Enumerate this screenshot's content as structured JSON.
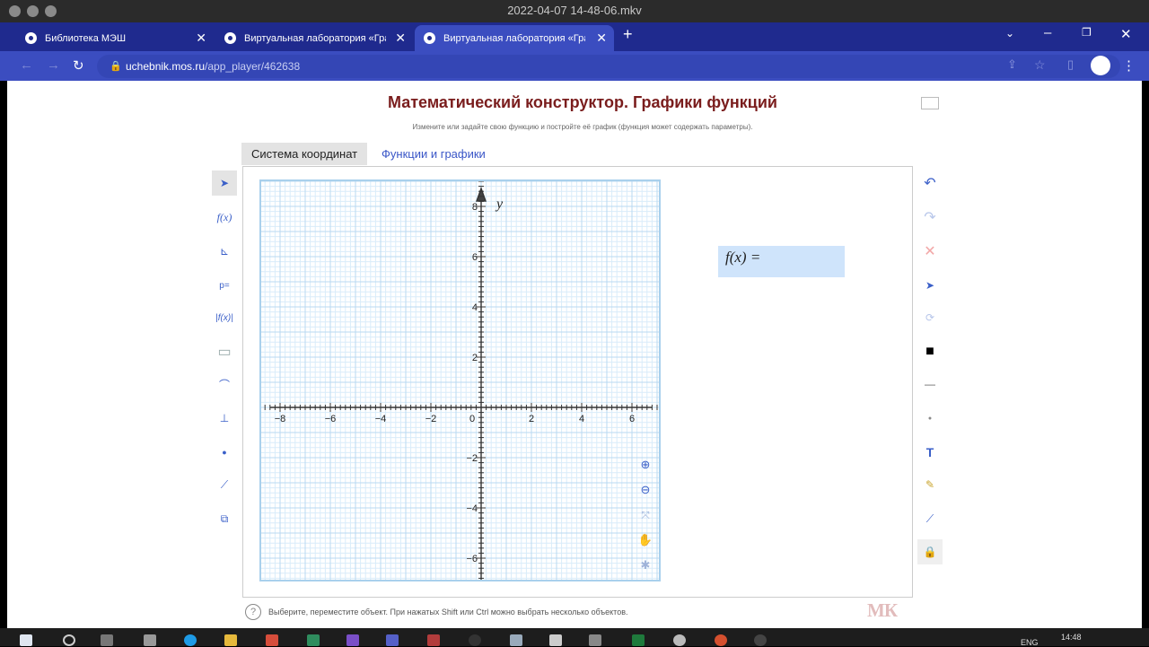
{
  "window": {
    "title": "2022-04-07 14-48-06.mkv"
  },
  "browser": {
    "tabs": [
      {
        "label": "Библиотека МЭШ",
        "active": false
      },
      {
        "label": "Виртуальная лаборатория «Гра",
        "active": false
      },
      {
        "label": "Виртуальная лаборатория «Гра",
        "active": true
      }
    ],
    "url_host": "uchebnik.mos.ru",
    "url_path": "/app_player/462638"
  },
  "app": {
    "title": "Математический конструктор. Графики функций",
    "subtitle": "Измените или задайте свою функцию и постройте её график (функция может содержать параметры).",
    "tabs": [
      {
        "label": "Система координат",
        "active": true
      },
      {
        "label": "Функции и графики",
        "active": false
      }
    ],
    "graph": {
      "y_axis_label": "y",
      "x_ticks": [
        "−8",
        "−6",
        "−4",
        "−2",
        "0",
        "2",
        "4",
        "6"
      ],
      "y_ticks": [
        "8",
        "6",
        "4",
        "2",
        "−2",
        "−4",
        "−6"
      ]
    },
    "function_tile": {
      "label": "f(x) ="
    },
    "left_tools": [
      "pointer-icon",
      "function-icon",
      "axes-icon",
      "parameter-icon",
      "abs-function-icon",
      "rectangle-icon",
      "tangent-icon",
      "axes-select-icon",
      "point-icon",
      "segment-icon",
      "transform-icon"
    ],
    "right_tools": [
      "undo-icon",
      "redo-icon",
      "delete-icon",
      "cursor-select-icon",
      "link-icon",
      "color-palette-icon",
      "line-style-icon",
      "point-style-icon",
      "text-icon",
      "brush-icon",
      "connect-icon",
      "lock-icon"
    ],
    "status": "Выберите, переместите объект. При нажатых Shift или Ctrl можно выбрать несколько объектов.",
    "logo": "МК"
  },
  "taskbar": {
    "time": "14:48",
    "lang": "ENG"
  }
}
